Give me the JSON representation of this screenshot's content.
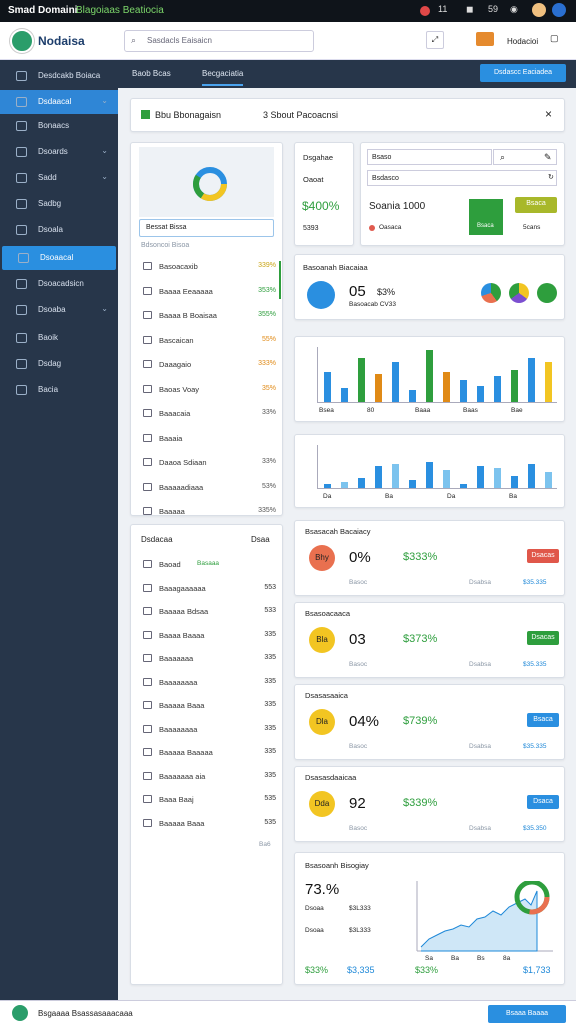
{
  "status_bar": {
    "app": "Smad Domaini",
    "subtitle": "Blagoiaas Beatiocia",
    "count1": "11",
    "count2": "59"
  },
  "app_header": {
    "title": "Nodaisa",
    "search_placeholder": "Sasdacls Eaisaicn",
    "user_label": "Hodacioi"
  },
  "sidebar": {
    "items": [
      {
        "label": "Desdcakb Boiaca",
        "icon": "clock-icon",
        "chevron": false
      },
      {
        "label": "Dsdaacal",
        "icon": "dashboard-icon",
        "chevron": true,
        "active": true
      },
      {
        "label": "Bonaacs",
        "icon": "users-icon",
        "chevron": false
      },
      {
        "label": "Dsoards",
        "icon": "pencil-icon",
        "chevron": true
      },
      {
        "label": "Sadd",
        "icon": "eye-icon",
        "chevron": true
      },
      {
        "label": "Sadbg",
        "icon": "folder-icon",
        "chevron": false
      },
      {
        "label": "Dsoala",
        "icon": "file-icon",
        "chevron": false
      },
      {
        "label": "Dsoaacal",
        "icon": "monitor-icon",
        "chevron": false,
        "highlight": true
      },
      {
        "label": "Dsoacadsicn",
        "icon": "list-icon",
        "chevron": false
      },
      {
        "label": "Dsoaba",
        "icon": "chart-icon",
        "chevron": true
      },
      {
        "label": "Baoik",
        "icon": "book-icon",
        "chevron": false
      },
      {
        "label": "Dsdag",
        "icon": "globe-icon",
        "chevron": false
      },
      {
        "label": "Bacia",
        "icon": "grid-icon",
        "chevron": false
      }
    ]
  },
  "tabs": {
    "items": [
      "Baob Bcas",
      "Becgaciatia"
    ],
    "action": "Dsdascc Eaciadea"
  },
  "banner": {
    "title": "Bbu Bbonagaisn",
    "subtitle": "3 Sbout Pacoacnsi",
    "close": "×"
  },
  "map_card": {
    "input": "Bessat Bissa",
    "caption": "Bdsoncoi Bisoa",
    "items": [
      {
        "label": "Basoacaxib",
        "value": "339%",
        "color": "#c9a516"
      },
      {
        "label": "Baaaa Eeaaaaa",
        "value": "353%",
        "color": "#2e9e3d"
      },
      {
        "label": "Baaaa B Boaisaa",
        "value": "355%",
        "color": "#2e9e3d"
      },
      {
        "label": "Bascaican",
        "value": "55%",
        "color": "#e08a16"
      },
      {
        "label": "Daaagaio",
        "value": "333%",
        "color": "#e08a16"
      },
      {
        "label": "Baoas Voay",
        "value": "35%",
        "color": "#e08a16"
      },
      {
        "label": "Baaacaia",
        "value": "33%",
        "color": "#555"
      },
      {
        "label": "Baaaia",
        "value": "",
        "color": "#555"
      },
      {
        "label": "Daaoa Sdiaan",
        "value": "33%",
        "color": "#555"
      },
      {
        "label": "Baaaaadiaaa",
        "value": "53%",
        "color": "#555"
      },
      {
        "label": "Baaaaa",
        "value": "335%",
        "color": "#555"
      }
    ]
  },
  "stat_card": {
    "title": "Dsgahae",
    "sub": "Oaoat",
    "value": "$400%",
    "foot": "5393"
  },
  "filter_card": {
    "field1": "Bsaso",
    "field2": "Bsdasco",
    "label": "Soania 1000",
    "legend": "Oasaca",
    "action": "Bsaca",
    "foot": "5cans"
  },
  "donut_card": {
    "title": "Basoanah Biacaiaa",
    "value": "05",
    "pct": "$3%",
    "sub": "Basoacab CV33"
  },
  "bar_chart1": {
    "labels": [
      "Bsea",
      "80",
      "Baaa",
      "Baas",
      "Bae"
    ]
  },
  "bar_chart2": {
    "labels": [
      "Da",
      "Ba",
      "Da",
      "Ba"
    ]
  },
  "kpi_cards": [
    {
      "title": "Bsasacah Bacaiacy",
      "badge": "Bhy",
      "badge_color": "#e9704f",
      "value": "0%",
      "money": "$333%",
      "btn": "Dsacas",
      "btn_color": "#e0574a",
      "f1": "Basoc",
      "f2": "Dsabsa",
      "f3": "$35.335"
    },
    {
      "title": "Bsasoacaaca",
      "badge": "Bla",
      "badge_color": "#f2c522",
      "value": "03",
      "money": "$373%",
      "btn": "Dsacas",
      "btn_color": "#2e9e3d",
      "f1": "Basoc",
      "f2": "Dsabsa",
      "f3": "$35.335"
    },
    {
      "title": "Dsasasaaica",
      "badge": "Dla",
      "badge_color": "#f2c522",
      "value": "04%",
      "money": "$739%",
      "btn": "Bsaca",
      "btn_color": "#2a8fe0",
      "f1": "Basoc",
      "f2": "Dsabsa",
      "f3": "$35.335"
    },
    {
      "title": "Dsasasdaaicaa",
      "badge": "Dda",
      "badge_color": "#f2c522",
      "value": "92",
      "money": "$339%",
      "btn": "Dsaca",
      "btn_color": "#2a8fe0",
      "f1": "Basoc",
      "f2": "Dsabsa",
      "f3": "$35.350"
    }
  ],
  "trend_card": {
    "title": "Bsasoanh Bisogiay",
    "value": "73.%",
    "r1a": "Dsoaa",
    "r1b": "$3L333",
    "r2a": "Dsoaa",
    "r2b": "$3L333",
    "foot": [
      "$33%",
      "$3,335",
      "$33%",
      "$1,733"
    ],
    "ticks": [
      "Sa",
      "Ba",
      "Bs",
      "8a"
    ]
  },
  "list_card": {
    "title": "Dsdacaa",
    "action": "Dsaa",
    "items": [
      {
        "label": "Baoad",
        "note": "Basaaa",
        "value": ""
      },
      {
        "label": "Baaagaaaaaa",
        "value": "553"
      },
      {
        "label": "Baaaaa Bdsaa",
        "value": "533"
      },
      {
        "label": "Baaaa Baaaa",
        "value": "335"
      },
      {
        "label": "Baaaaaaa",
        "value": "335"
      },
      {
        "label": "Baaaaaaaa",
        "value": "335"
      },
      {
        "label": "Baaaaa Baaa",
        "value": "335"
      },
      {
        "label": "Baaaaaaaa",
        "value": "335"
      },
      {
        "label": "Baaaaa Baaaaa",
        "value": "335"
      },
      {
        "label": "Baaaaaaa aia",
        "value": "335"
      },
      {
        "label": "Baaa Baaj",
        "value": "535"
      },
      {
        "label": "Baaaaa Baaa",
        "value": "535"
      }
    ],
    "foot": "Ba6"
  },
  "footer": {
    "label": "Bsgaaaa Bsassasaaacaaa",
    "action": "Bsaaa Baaaa"
  }
}
